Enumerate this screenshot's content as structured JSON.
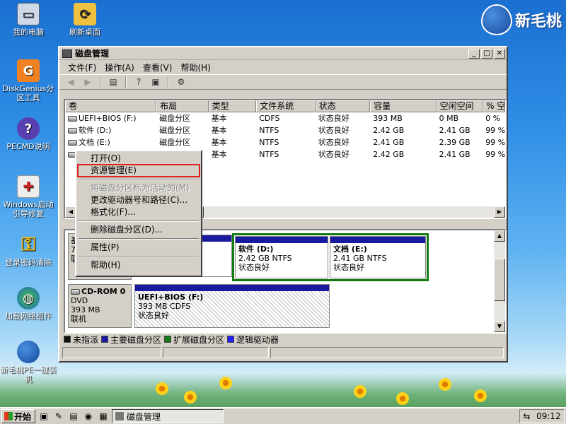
{
  "brand": {
    "text": "新毛桃"
  },
  "desktop_icons": [
    {
      "label": "我的电脑"
    },
    {
      "label": "刷新桌面"
    },
    {
      "label": "DiskGenius分区工具"
    },
    {
      "label": "PECMD说明"
    },
    {
      "label": "Windows启动引导修复"
    },
    {
      "label": "登录密码清除"
    },
    {
      "label": "加载网络组件"
    },
    {
      "label": "新毛桃PE一键装机"
    }
  ],
  "window": {
    "title": "磁盘管理",
    "menu": [
      "文件(F)",
      "操作(A)",
      "查看(V)",
      "帮助(H)"
    ]
  },
  "list": {
    "columns": [
      "卷",
      "布局",
      "类型",
      "文件系统",
      "状态",
      "容量",
      "空闲空间",
      "% 空"
    ],
    "rows": [
      [
        "UEFI+BIOS (F:)",
        "磁盘分区",
        "基本",
        "CDFS",
        "状态良好",
        "393 MB",
        "0 MB",
        "0 %"
      ],
      [
        "软件 (D:)",
        "磁盘分区",
        "基本",
        "NTFS",
        "状态良好",
        "2.42 GB",
        "2.41 GB",
        "99 %"
      ],
      [
        "文档 (E:)",
        "磁盘分区",
        "基本",
        "NTFS",
        "状态良好",
        "2.41 GB",
        "2.39 GB",
        "99 %"
      ],
      [
        "",
        "",
        "基本",
        "NTFS",
        "状态良好",
        "2.42 GB",
        "2.41 GB",
        "99 %"
      ]
    ]
  },
  "graph": {
    "disk0_partial": [
      "基",
      "7.",
      "联"
    ],
    "partitions": [
      {
        "title": "软件 (D:)",
        "size": "2.42 GB NTFS",
        "status": "状态良好"
      },
      {
        "title": "文档 (E:)",
        "size": "2.41 GB NTFS",
        "status": "状态良好"
      }
    ],
    "cdrom": {
      "name": "CD-ROM 0",
      "type": "DVD",
      "size": "393 MB",
      "state": "联机"
    },
    "cd_partition": {
      "title": "UEFI+BIOS (F:)",
      "size": "393 MB CDFS",
      "status": "状态良好"
    }
  },
  "legend": [
    {
      "label": "未指派",
      "color": "#111111"
    },
    {
      "label": "主要磁盘分区",
      "color": "#1a1aa0"
    },
    {
      "label": "扩展磁盘分区",
      "color": "#127a12"
    },
    {
      "label": "逻辑驱动器",
      "color": "#2020ff"
    }
  ],
  "context_menu": [
    {
      "label": "打开(O)",
      "enabled": true
    },
    {
      "label": "资源管理(E)",
      "enabled": true,
      "highlighted": true
    },
    {
      "label": "将磁盘分区标为活动的(M)",
      "enabled": false
    },
    {
      "label": "更改驱动器号和路径(C)...",
      "enabled": true
    },
    {
      "label": "格式化(F)...",
      "enabled": true
    },
    {
      "label": "删除磁盘分区(D)...",
      "enabled": true
    },
    {
      "label": "属性(P)",
      "enabled": true
    },
    {
      "label": "帮助(H)",
      "enabled": true
    }
  ],
  "taskbar": {
    "start": "开始",
    "task": "磁盘管理",
    "clock": "09:12"
  }
}
